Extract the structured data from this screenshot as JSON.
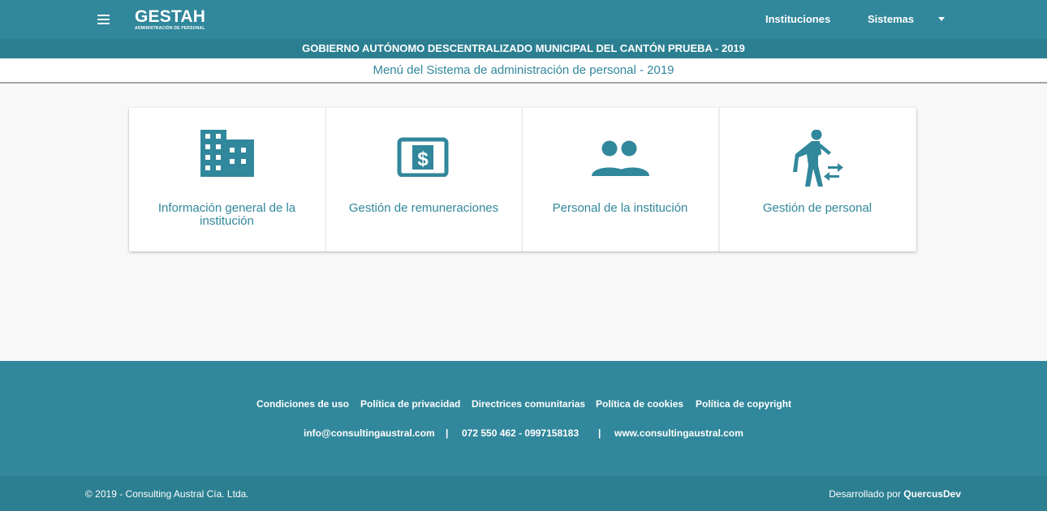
{
  "header": {
    "logo_title": "GESTAH",
    "logo_subtitle": "ADMINISTRACIÓN DE PERSONAL",
    "nav_institutions": "Instituciones",
    "nav_systems": "Sistemas",
    "menu_icon": "hamburger-menu-icon",
    "dropdown_icon": "caret-down-icon"
  },
  "gov_title": "GOBIERNO AUTÓNOMO DESCENTRALIZADO MUNICIPAL DEL CANTÓN PRUEBA - 2019",
  "subtitle": "Menú del Sistema de administración de personal - 2019",
  "cards": [
    {
      "label": "Información general de la institución",
      "icon": "building-icon"
    },
    {
      "label": "Gestión de remuneraciones",
      "icon": "money-bill-icon"
    },
    {
      "label": "Personal de la institución",
      "icon": "people-icon"
    },
    {
      "label": "Gestión de personal",
      "icon": "person-transfer-icon"
    }
  ],
  "footer": {
    "links": [
      "Condiciones de uso",
      "Política de privacidad",
      "Directrices comunitarias",
      "Política de cookies",
      "Política de copyright"
    ],
    "email": "info@consultingaustral.com",
    "separator": "|",
    "phones": "072 550 462 - 0997158183",
    "website": "www.consultingaustral.com",
    "copyright": "© 2019 - Consulting Austral Cía. Ltda.",
    "developed_by_prefix": "Desarrollado por",
    "developer": "QuercusDev"
  },
  "colors": {
    "primary": "#31879b",
    "primary_dark": "#2b7f91",
    "background": "#f8f8f8",
    "card_background": "#ffffff"
  }
}
